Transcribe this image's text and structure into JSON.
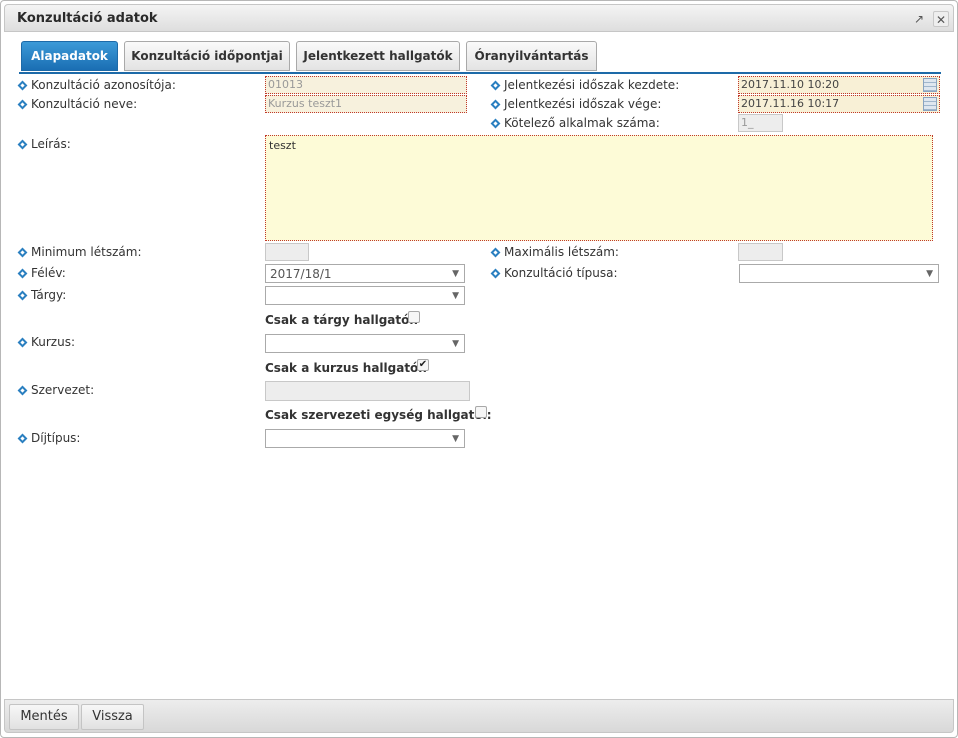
{
  "window": {
    "title": "Konzultáció adatok",
    "popout_icon": "popout-icon",
    "close_icon": "close-icon"
  },
  "tabs": [
    {
      "label": "Alapadatok",
      "active": true
    },
    {
      "label": "Konzultáció időpontjai",
      "active": false
    },
    {
      "label": "Jelentkezett hallgatók",
      "active": false
    },
    {
      "label": "Óranyilvántartás",
      "active": false
    }
  ],
  "fields": {
    "id": {
      "label": "Konzultáció azonosítója:",
      "value": "01013"
    },
    "name": {
      "label": "Konzultáció neve:",
      "value": "Kurzus teszt1"
    },
    "reg_start": {
      "label": "Jelentkezési időszak kezdete:",
      "value": "2017.11.10 10:20"
    },
    "reg_end": {
      "label": "Jelentkezési időszak vége:",
      "value": "2017.11.16 10:17"
    },
    "mandatory": {
      "label": "Kötelező alkalmak száma:",
      "value": "1_"
    },
    "description": {
      "label": "Leírás:",
      "value": "teszt"
    },
    "min_count": {
      "label": "Minimum létszám:",
      "value": ""
    },
    "max_count": {
      "label": "Maximális létszám:",
      "value": ""
    },
    "semester": {
      "label": "Félév:",
      "value": "2017/18/1"
    },
    "type": {
      "label": "Konzultáció típusa:",
      "value": ""
    },
    "subject": {
      "label": "Tárgy:",
      "value": ""
    },
    "subject_only": {
      "label": "Csak a tárgy hallgatói:",
      "checked": false
    },
    "course": {
      "label": "Kurzus:",
      "value": ""
    },
    "course_only": {
      "label": "Csak a kurzus hallgatói:",
      "checked": true
    },
    "org": {
      "label": "Szervezet:",
      "value": ""
    },
    "org_only": {
      "label": "Csak szervezeti egység hallgatói:",
      "checked": false
    },
    "fee": {
      "label": "Díjtípus:",
      "value": ""
    }
  },
  "footer": {
    "save_label": "Mentés",
    "back_label": "Vissza"
  }
}
